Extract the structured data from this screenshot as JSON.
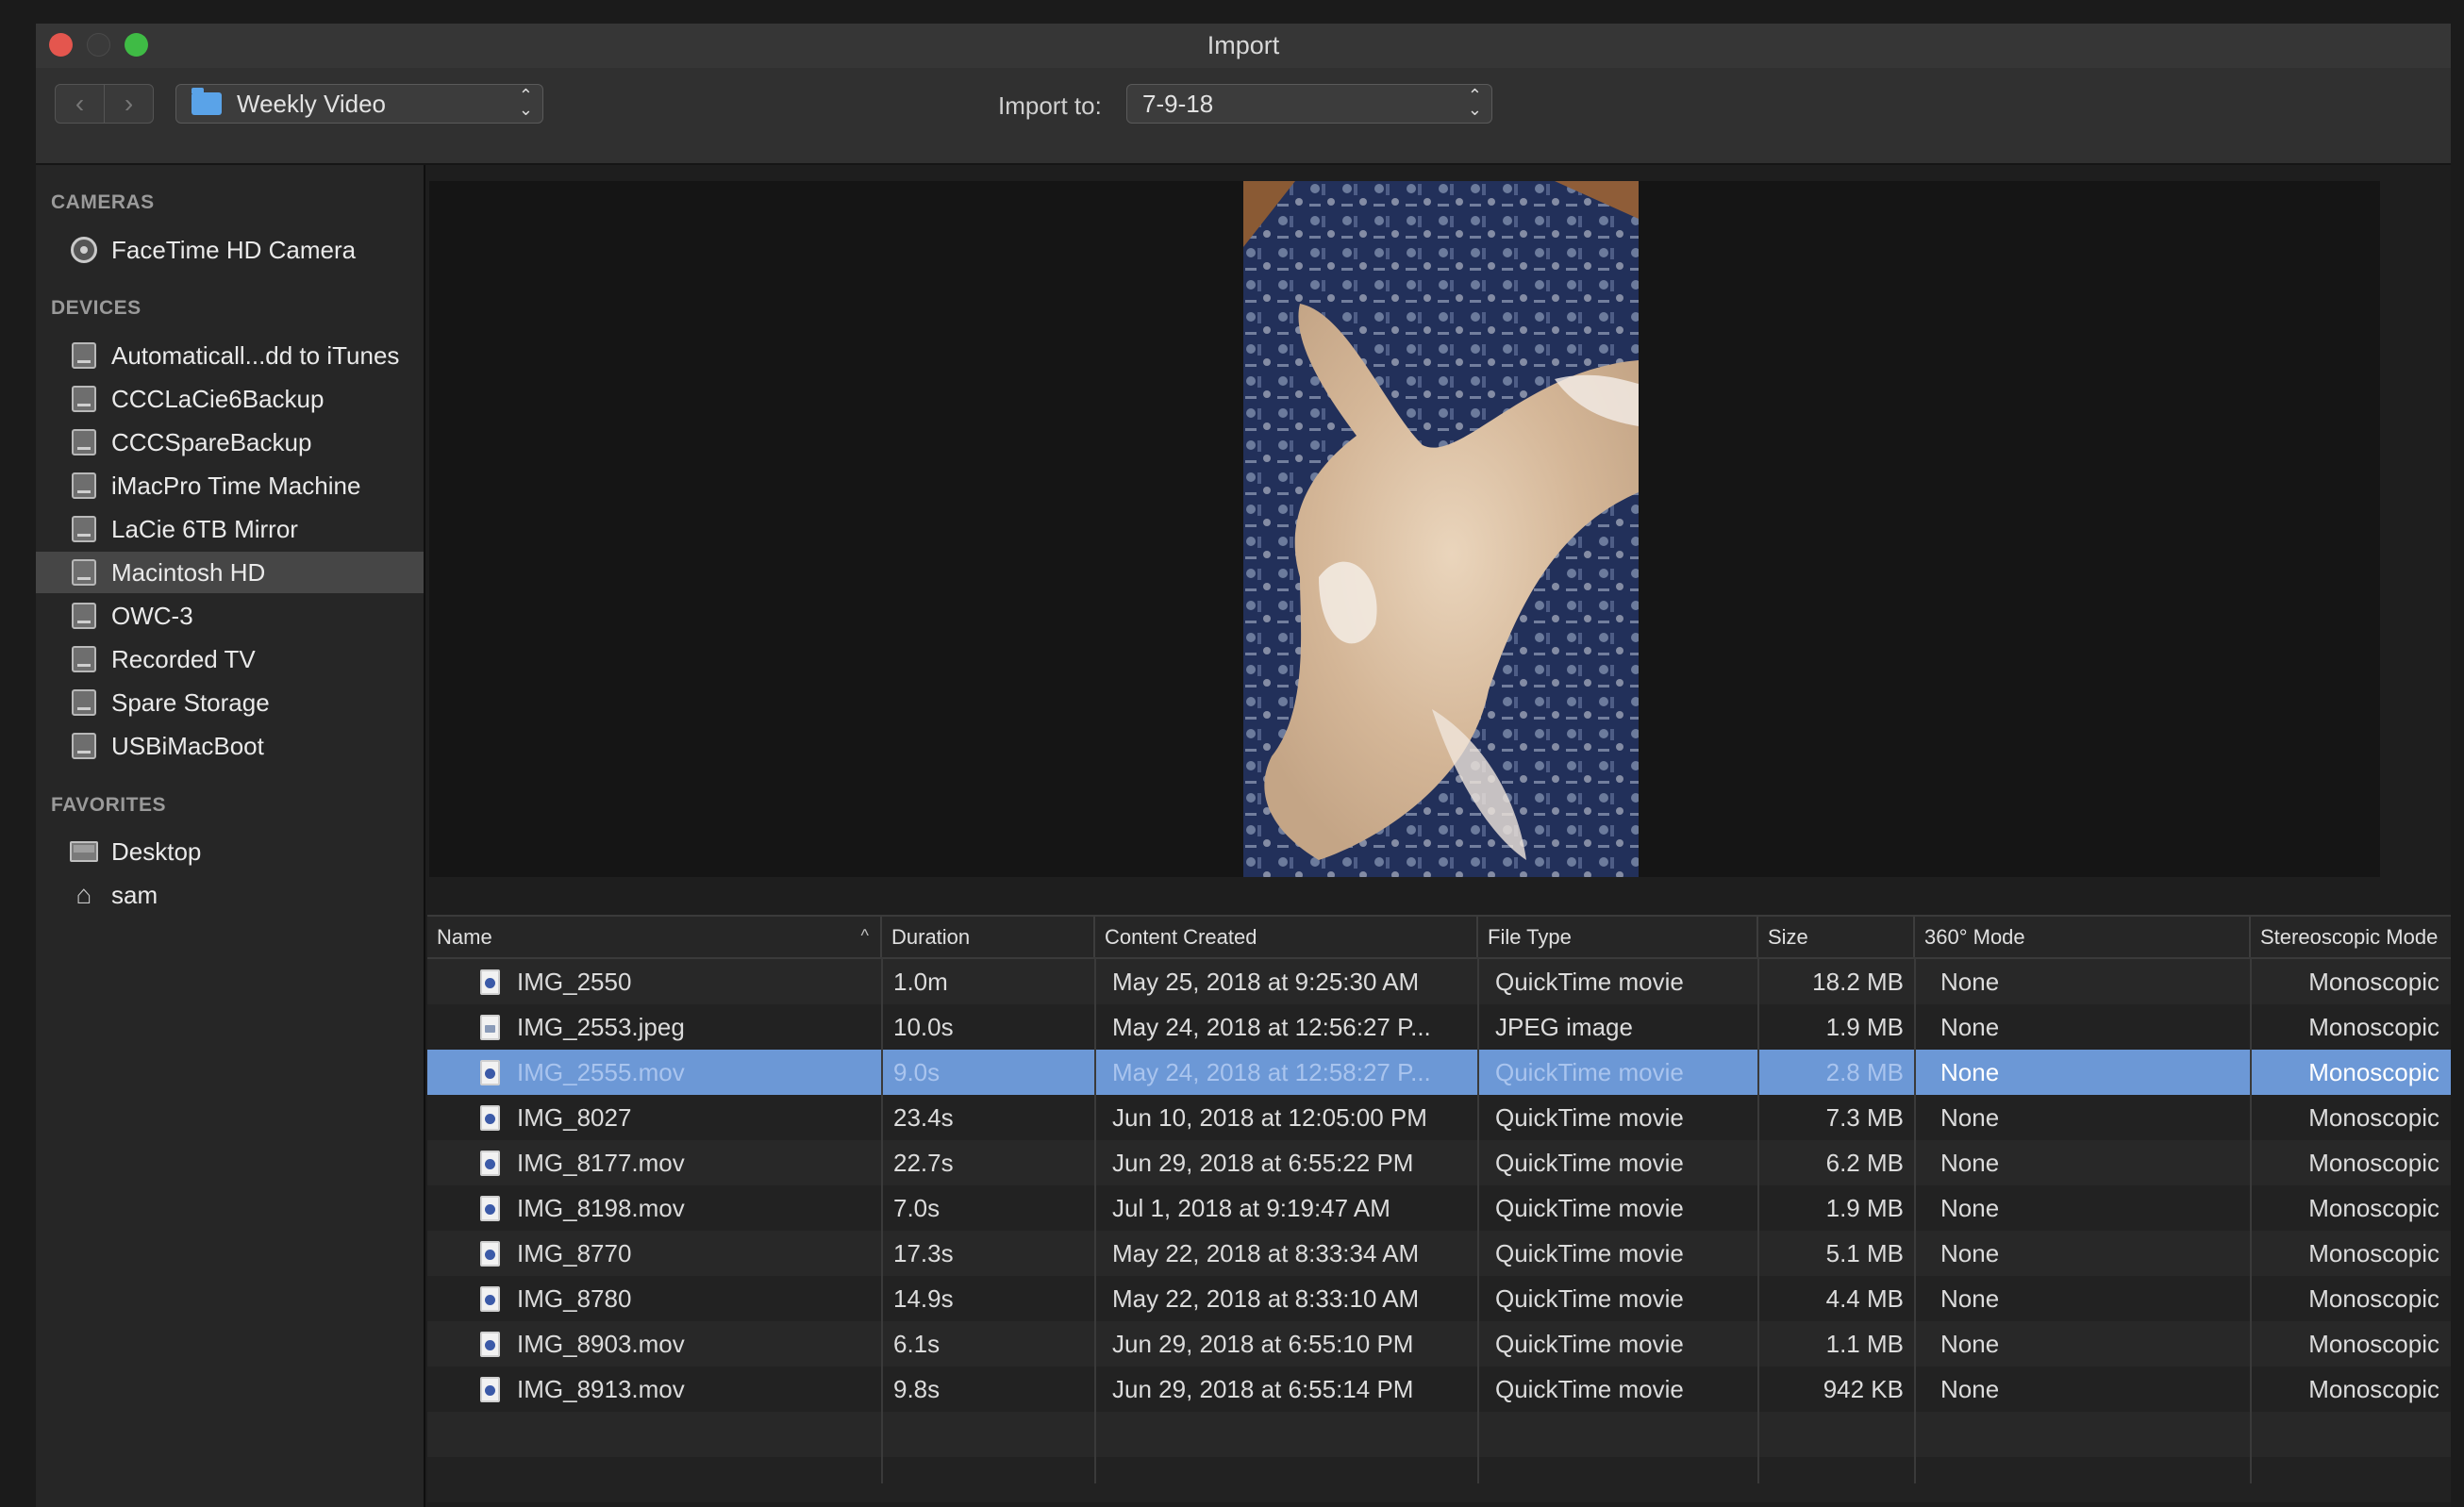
{
  "window": {
    "title": "Import"
  },
  "toolbar": {
    "source": "Weekly Video",
    "import_to_label": "Import to:",
    "import_to_value": "7-9-18"
  },
  "sidebar": {
    "cameras_title": "CAMERAS",
    "cameras": [
      {
        "label": "FaceTime HD Camera",
        "icon": "camera-icon"
      }
    ],
    "devices_title": "DEVICES",
    "devices": [
      {
        "label": "Automaticall...dd to iTunes",
        "icon": "disk-icon"
      },
      {
        "label": "CCCLaCie6Backup",
        "icon": "disk-icon"
      },
      {
        "label": "CCCSpareBackup",
        "icon": "disk-icon"
      },
      {
        "label": "iMacPro Time Machine",
        "icon": "disk-icon"
      },
      {
        "label": "LaCie 6TB Mirror",
        "icon": "disk-icon"
      },
      {
        "label": "Macintosh HD",
        "icon": "disk-icon",
        "selected": true
      },
      {
        "label": "OWC-3",
        "icon": "disk-icon"
      },
      {
        "label": "Recorded TV",
        "icon": "disk-icon"
      },
      {
        "label": "Spare Storage",
        "icon": "disk-icon"
      },
      {
        "label": "USBiMacBoot",
        "icon": "disk-icon"
      }
    ],
    "favorites_title": "FAVORITES",
    "favorites": [
      {
        "label": "Desktop",
        "icon": "desktop-icon"
      },
      {
        "label": "sam",
        "icon": "home-icon"
      }
    ]
  },
  "table": {
    "columns": [
      "Name",
      "Duration",
      "Content Created",
      "File Type",
      "Size",
      "360° Mode",
      "Stereoscopic Mode"
    ],
    "sorted_by": "Name",
    "rows": [
      {
        "name": "IMG_2550",
        "duration": "1.0m",
        "created": "May 25, 2018 at 9:25:30 AM",
        "type": "QuickTime movie",
        "size": "18.2 MB",
        "mode360": "None",
        "stereo": "Monoscopic"
      },
      {
        "name": "IMG_2553.jpeg",
        "duration": "10.0s",
        "created": "May 24, 2018 at 12:56:27 P...",
        "type": "JPEG image",
        "size": "1.9 MB",
        "mode360": "None",
        "stereo": "Monoscopic"
      },
      {
        "name": "IMG_2555.mov",
        "duration": "9.0s",
        "created": "May 24, 2018 at 12:58:27 P...",
        "type": "QuickTime movie",
        "size": "2.8 MB",
        "mode360": "None",
        "stereo": "Monoscopic",
        "selected": true
      },
      {
        "name": "IMG_8027",
        "duration": "23.4s",
        "created": "Jun 10, 2018 at 12:05:00 PM",
        "type": "QuickTime movie",
        "size": "7.3 MB",
        "mode360": "None",
        "stereo": "Monoscopic"
      },
      {
        "name": "IMG_8177.mov",
        "duration": "22.7s",
        "created": "Jun 29, 2018 at 6:55:22 PM",
        "type": "QuickTime movie",
        "size": "6.2 MB",
        "mode360": "None",
        "stereo": "Monoscopic"
      },
      {
        "name": "IMG_8198.mov",
        "duration": "7.0s",
        "created": "Jul 1, 2018 at 9:19:47 AM",
        "type": "QuickTime movie",
        "size": "1.9 MB",
        "mode360": "None",
        "stereo": "Monoscopic"
      },
      {
        "name": "IMG_8770",
        "duration": "17.3s",
        "created": "May 22, 2018 at 8:33:34 AM",
        "type": "QuickTime movie",
        "size": "5.1 MB",
        "mode360": "None",
        "stereo": "Monoscopic"
      },
      {
        "name": "IMG_8780",
        "duration": "14.9s",
        "created": "May 22, 2018 at 8:33:10 AM",
        "type": "QuickTime movie",
        "size": "4.4 MB",
        "mode360": "None",
        "stereo": "Monoscopic"
      },
      {
        "name": "IMG_8903.mov",
        "duration": "6.1s",
        "created": "Jun 29, 2018 at 6:55:10 PM",
        "type": "QuickTime movie",
        "size": "1.1 MB",
        "mode360": "None",
        "stereo": "Monoscopic"
      },
      {
        "name": "IMG_8913.mov",
        "duration": "9.8s",
        "created": "Jun 29, 2018 at 6:55:14 PM",
        "type": "QuickTime movie",
        "size": "942 KB",
        "mode360": "None",
        "stereo": "Monoscopic"
      }
    ]
  },
  "colors": {
    "selection": "#6c98d6",
    "folder": "#5aa3e8",
    "close": "#e4564e",
    "zoom": "#3fbb45"
  }
}
